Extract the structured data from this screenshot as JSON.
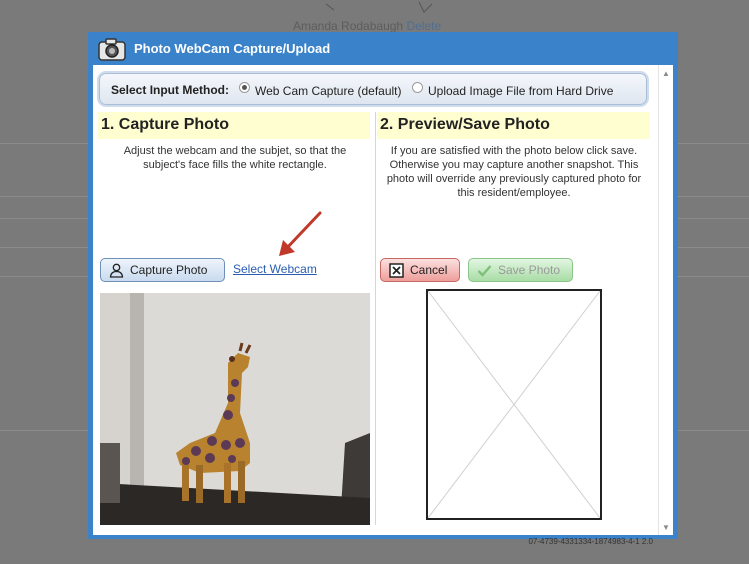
{
  "background": {
    "caption_name": "Amanda Rodabaugh",
    "caption_action": "Delete"
  },
  "dialog": {
    "title": "Photo WebCam Capture/Upload",
    "method": {
      "label": "Select Input Method:",
      "options": [
        {
          "label": "Web Cam Capture (default)",
          "selected": true
        },
        {
          "label": "Upload Image File from Hard Drive",
          "selected": false
        }
      ]
    },
    "capture": {
      "heading": "1. Capture Photo",
      "instructions": "Adjust the webcam and the subjet, so that the subject's face fills the white rectangle.",
      "capture_button": "Capture Photo",
      "select_webcam_link": "Select Webcam"
    },
    "preview": {
      "heading": "2. Preview/Save Photo",
      "instructions": "If you are satisfied with the photo below click save. Otherwise you may capture another snapshot. This photo will override any previously captured photo for this resident/employee.",
      "cancel_button": "Cancel",
      "save_button": "Save Photo"
    },
    "build_id": "07-4739-4331334-1874983-4-1 2.0"
  },
  "colors": {
    "dialog_frame": "#3a82c9",
    "heading_bg": "#fffed0",
    "link": "#2a5db0",
    "annotation_arrow": "#c0392b"
  },
  "icons": [
    "camera-icon",
    "user-icon",
    "close-box-icon",
    "checkmark-icon",
    "annotation-arrow"
  ]
}
